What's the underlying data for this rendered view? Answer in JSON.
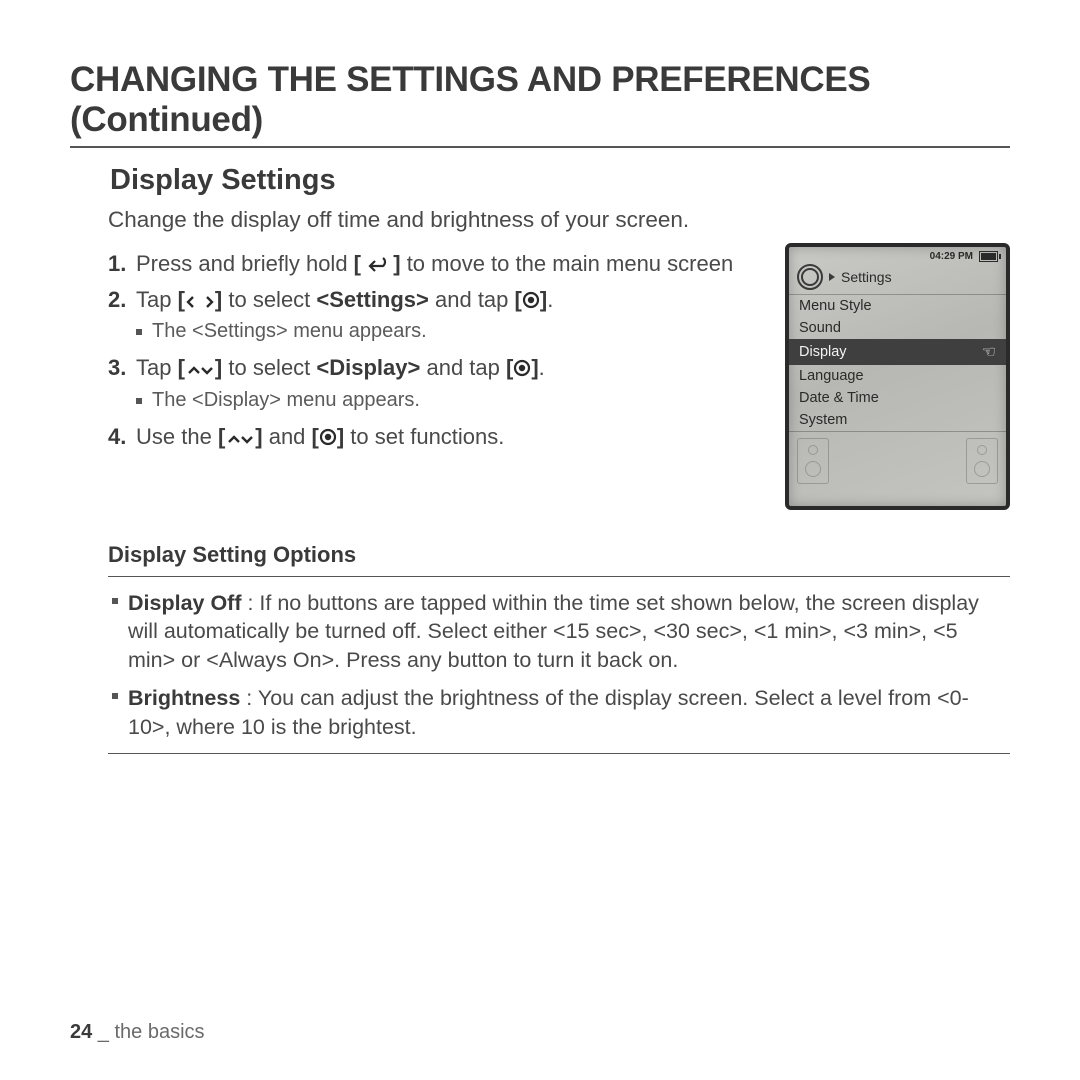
{
  "main_title": "CHANGING THE SETTINGS AND PREFERENCES (Continued)",
  "section_title": "Display Settings",
  "intro": "Change the display off time and brightness of your screen.",
  "steps": {
    "s1": {
      "num": "1.",
      "pre": "Press and briefly hold ",
      "post": " to move to the main menu screen"
    },
    "s2": {
      "num": "2.",
      "pre": "Tap ",
      "mid": " to select ",
      "target": "<Settings>",
      "post2": " and tap ",
      "end": "."
    },
    "s2_sub": "The <Settings> menu appears.",
    "s3": {
      "num": "3.",
      "pre": "Tap ",
      "mid": " to select ",
      "target": "<Display>",
      "post2": " and tap ",
      "end": "."
    },
    "s3_sub": "The <Display> menu appears.",
    "s4": {
      "num": "4.",
      "pre": "Use the ",
      "mid": " and ",
      "post": " to set functions."
    }
  },
  "options_title": "Display Setting Options",
  "options": {
    "o1": {
      "label": "Display Off",
      "text": " : If no buttons are tapped within the time set shown below, the screen display will automatically be turned off. Select either <15 sec>, <30 sec>, <1 min>, <3 min>, <5 min> or <Always On>. Press any button to turn it back on."
    },
    "o2": {
      "label": "Brightness",
      "text": " : You can adjust the brightness of the display screen. Select a level from <0-10>, where 10 is the brightest."
    }
  },
  "device": {
    "time": "04:29 PM",
    "heading": "Settings",
    "items": [
      "Menu Style",
      "Sound",
      "Display",
      "Language",
      "Date & Time",
      "System"
    ],
    "selected_index": 2
  },
  "footer": {
    "page": "24",
    "sep": " _ ",
    "section": "the basics"
  }
}
